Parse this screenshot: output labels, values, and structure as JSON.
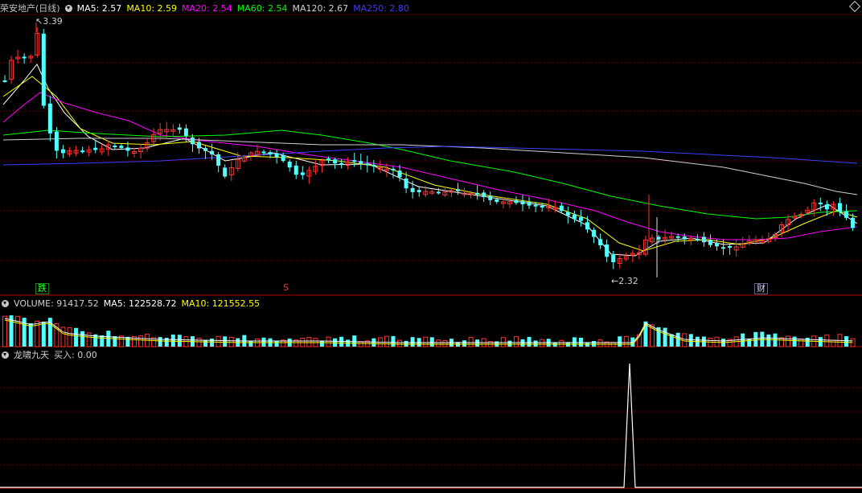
{
  "main_header": {
    "title": "荣安地产(日线)",
    "indicators": [
      {
        "label": "MA5: 2.57",
        "color": "#ffffff"
      },
      {
        "label": "MA10: 2.59",
        "color": "#ffff00"
      },
      {
        "label": "MA20: 2.54",
        "color": "#ff00ff"
      },
      {
        "label": "MA60: 2.54",
        "color": "#00ff00"
      },
      {
        "label": "MA120: 2.67",
        "color": "#d0d0d0"
      },
      {
        "label": "MA250: 2.80",
        "color": "#0000ff"
      }
    ]
  },
  "volume_header": {
    "title": "VOLUME: 91417.52",
    "ma5": "MA5: 122528.72",
    "ma10": "MA10: 121552.55"
  },
  "signal_header": {
    "title": "龙啸九天",
    "buy": "买入: 0.00"
  },
  "annotations": {
    "high": "3.39",
    "low": "2.32"
  },
  "markers": {
    "drop": "跌",
    "s": "S",
    "fin": "财"
  },
  "colors": {
    "bg": "#000000",
    "up": "#ff3232",
    "down": "#54ffff",
    "grid": "#7a0000",
    "divider": "#b00000"
  },
  "chart_data": {
    "type": "candlestick",
    "high_label": 3.39,
    "low_label": 2.32,
    "ma_last": {
      "MA5": 2.57,
      "MA10": 2.59,
      "MA20": 2.54,
      "MA60": 2.54,
      "MA120": 2.67,
      "MA250": 2.8
    },
    "volume_last": 91417.52,
    "signal_spike_index": 112
  }
}
